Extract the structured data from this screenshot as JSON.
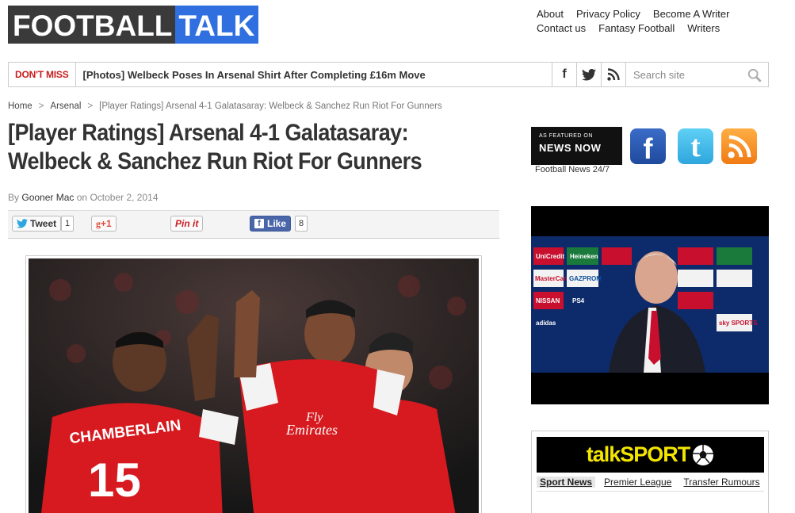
{
  "logo": {
    "part1": "FOOTBALL",
    "part2": "TALK"
  },
  "top_links": {
    "row1": [
      "About",
      "Privacy Policy",
      "Become A Writer"
    ],
    "row2": [
      "Contact us",
      "Fantasy Football",
      "Writers"
    ]
  },
  "dont_miss": {
    "label": "DON'T MISS",
    "headline": "[Photos] Welbeck Poses In Arsenal Shirt After Completing £16m Move"
  },
  "social_small": {
    "facebook": "f",
    "twitter": "twitter-icon",
    "rss": "rss-icon"
  },
  "search": {
    "placeholder": "Search site"
  },
  "breadcrumb": {
    "home": "Home",
    "sep": ">",
    "section": "Arsenal",
    "current": "[Player Ratings] Arsenal 4-1 Galatasaray: Welbeck & Sanchez Run Riot For Gunners"
  },
  "article": {
    "title_line1": "[Player Ratings] Arsenal 4-1 Galatasaray:",
    "title_line2": "Welbeck & Sanchez Run Riot For Gunners",
    "by": "By",
    "author": "Gooner Mac",
    "on": "on",
    "date": "October 2, 2014"
  },
  "share": {
    "tweet_label": "Tweet",
    "tweet_count": "1",
    "gplus_label": "+1",
    "pinit_label": "Pin it",
    "like_label": "Like",
    "like_count": "8"
  },
  "hero": {
    "shirt_name": "CHAMBERLAIN",
    "shirt_number": "15",
    "sponsor_line1": "Fly",
    "sponsor_line2": "Emirates"
  },
  "sidebar": {
    "news_now_small": "AS FEATURED ON",
    "news_now_big": "NEWS NOW",
    "news_caption": "Football News 24/7",
    "fb": "f",
    "tw": "t",
    "rss": "rss"
  },
  "video": {
    "sponsors": [
      "UniCredit",
      "Heineken",
      "GAZPROM",
      "MasterCard",
      "PS4",
      "NISSAN",
      "adidas",
      "sky SPORTS"
    ]
  },
  "talksport": {
    "logo": "talkSPORT",
    "tabs": [
      "Sport News",
      "Premier League",
      "Transfer Rumours"
    ]
  },
  "colors": {
    "accent_red": "#c81d1d",
    "logo_blue": "#2f6fe0",
    "arsenal_red": "#d61a1f",
    "talksport_yellow": "#f3e500"
  }
}
